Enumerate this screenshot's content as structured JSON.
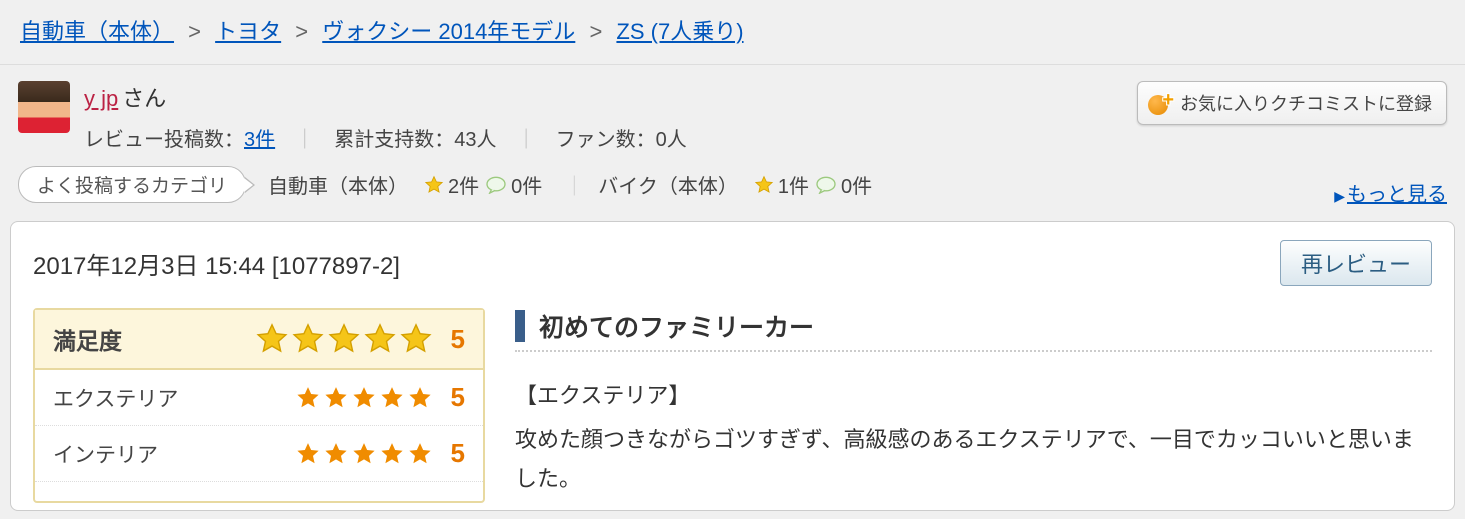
{
  "breadcrumb": {
    "items": [
      "自動車（本体）",
      "トヨタ",
      "ヴォクシー 2014年モデル",
      "ZS (7人乗り)"
    ],
    "separator": ">"
  },
  "user": {
    "name": "y jp",
    "suffix": "さん",
    "review_count_label": "レビュー投稿数：",
    "review_count": "3件",
    "support_label": "累計支持数：",
    "support_value": "43人",
    "fans_label": "ファン数：",
    "fans_value": "0人"
  },
  "favorite_button": "お気に入りクチコミストに登録",
  "freq": {
    "label": "よく投稿するカテゴリ",
    "categories": [
      {
        "name": "自動車（本体）",
        "reviews": "2件",
        "comments": "0件"
      },
      {
        "name": "バイク（本体）",
        "reviews": "1件",
        "comments": "0件"
      }
    ],
    "more": "もっと見る"
  },
  "review": {
    "datetime": "2017年12月3日 15:44",
    "id": "[1077897-2]",
    "rereview_btn": "再レビュー",
    "title": "初めてのファミリーカー",
    "ratings": {
      "overall": {
        "label": "満足度",
        "value": "5"
      },
      "items": [
        {
          "label": "エクステリア",
          "value": "5"
        },
        {
          "label": "インテリア",
          "value": "5"
        }
      ]
    },
    "body": {
      "section_heading": "【エクステリア】",
      "paragraph": "攻めた顔つきながらゴツすぎず、高級感のあるエクステリアで、一目でカッコいいと思いました。"
    }
  }
}
